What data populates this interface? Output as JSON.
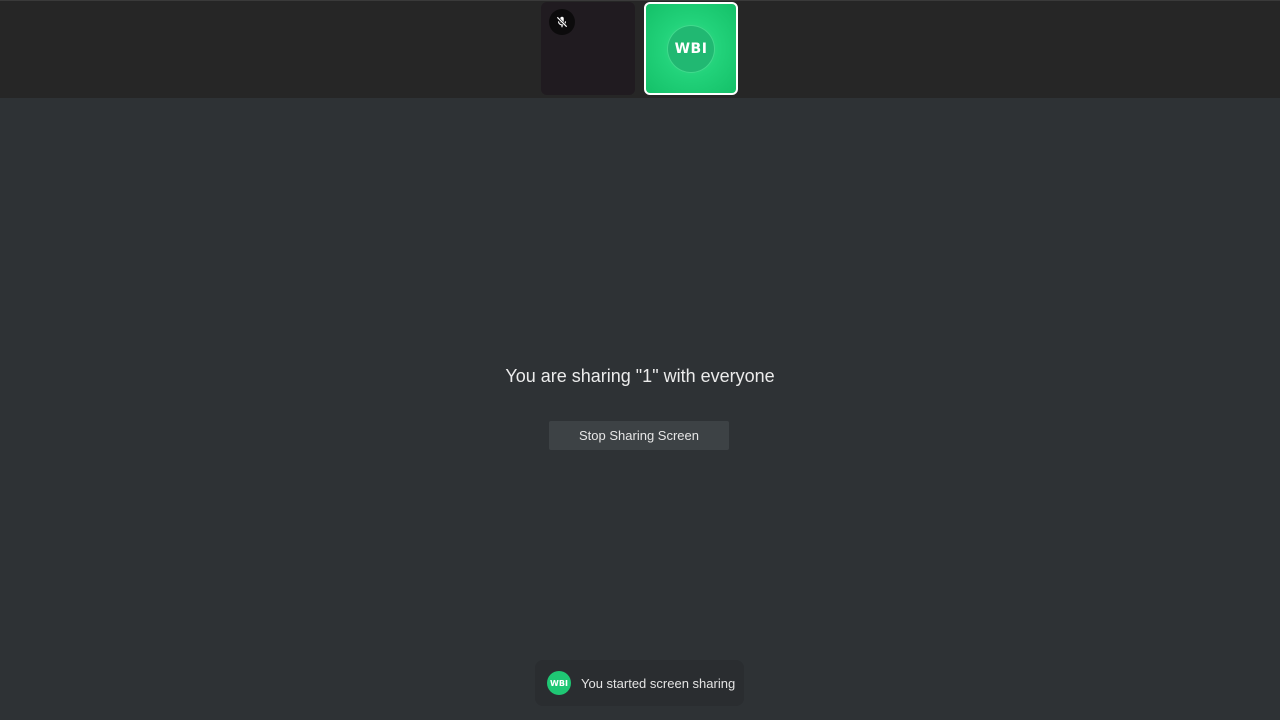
{
  "participants": [
    {
      "state": "muted",
      "icon": "mic-off-icon"
    },
    {
      "avatar_text": "WBI",
      "tile_color": "#22d27a",
      "active": true
    }
  ],
  "share": {
    "message": "You are sharing \"1\" with everyone",
    "stop_button_label": "Stop Sharing Screen"
  },
  "toast": {
    "avatar_text": "WBI",
    "message": "You started screen sharing"
  },
  "colors": {
    "background": "#2e3235",
    "top_strip": "#262626",
    "accent_green": "#22d27a",
    "button_bg": "#3d4245"
  }
}
